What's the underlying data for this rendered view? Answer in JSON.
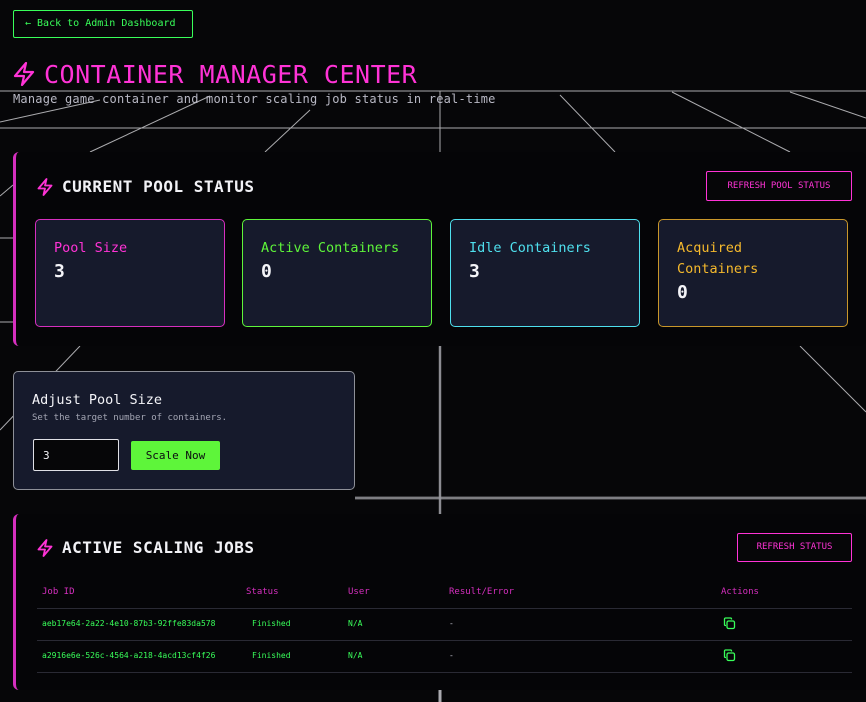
{
  "nav": {
    "back_label": "← Back to Admin Dashboard"
  },
  "header": {
    "title": "CONTAINER MANAGER CENTER",
    "subtitle": "Manage game container and monitor scaling job status in real-time"
  },
  "pool_status": {
    "title": "CURRENT POOL STATUS",
    "refresh_label": "REFRESH POOL STATUS",
    "stats": [
      {
        "label": "Pool Size",
        "value": "3",
        "color": "#ff33d6"
      },
      {
        "label": "Active Containers",
        "value": "0",
        "color": "#5ef53a"
      },
      {
        "label": "Idle Containers",
        "value": "3",
        "color": "#4fe0ee"
      },
      {
        "label": "Acquired Containers",
        "value": "0",
        "color": "#f5b92c"
      }
    ]
  },
  "adjust": {
    "title": "Adjust Pool Size",
    "hint": "Set the target number of containers.",
    "input_value": "3",
    "button_label": "Scale Now"
  },
  "jobs": {
    "title": "ACTIVE SCALING JOBS",
    "refresh_label": "REFRESH STATUS",
    "columns": [
      "Job ID",
      "Status",
      "User",
      "Result/Error",
      "Actions"
    ],
    "rows": [
      {
        "job_id": "aeb17e64-2a22-4e10-87b3-92ffe83da578",
        "status": "Finished",
        "user": "N/A",
        "result": "-",
        "action_icon": "copy-icon"
      },
      {
        "job_id": "a2916e6e-526c-4564-a218-4acd13cf4f26",
        "status": "Finished",
        "user": "N/A",
        "result": "-",
        "action_icon": "copy-icon"
      }
    ]
  },
  "colors": {
    "accent_pink": "#ff33d6",
    "accent_green": "#39ff5a",
    "panel_bg": "#161a2c"
  }
}
